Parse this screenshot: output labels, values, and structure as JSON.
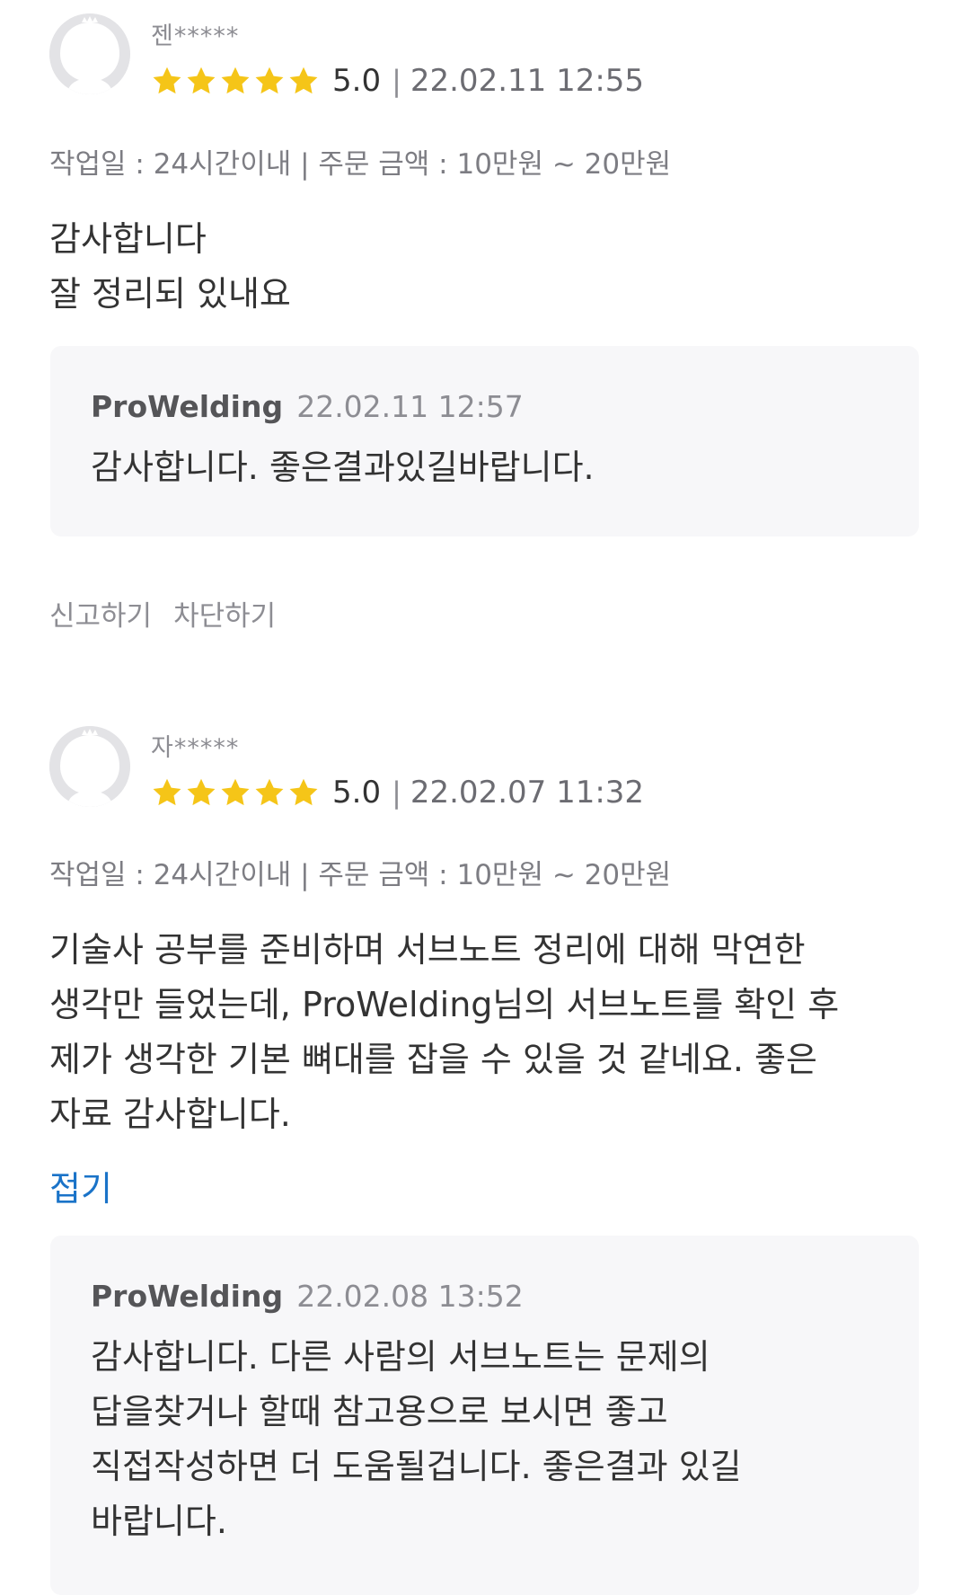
{
  "reviews": [
    {
      "author": "젠*****",
      "rating_value": 5,
      "score": "5.0",
      "separator": "|",
      "date": "22.02.11 12:55",
      "meta": "작업일 : 24시간이내 | 주문 금액 : 10만원 ~ 20만원",
      "body": "감사합니다\n잘 정리되 있내요",
      "reply": {
        "name": "ProWelding",
        "date": "22.02.11 12:57",
        "text": "감사합니다. 좋은결과있길바랍니다."
      },
      "actions": {
        "report": "신고하기",
        "block": "차단하기"
      }
    },
    {
      "author": "자*****",
      "rating_value": 5,
      "score": "5.0",
      "separator": "|",
      "date": "22.02.07 11:32",
      "meta": "작업일 : 24시간이내 | 주문 금액 : 10만원 ~ 20만원",
      "body": "기술사 공부를 준비하며 서브노트 정리에 대해 막연한\n생각만 들었는데, ProWelding님의 서브노트를 확인 후\n제가 생각한 기본 뼈대를 잡을 수 있을 것 같네요.  좋은\n자료 감사합니다.",
      "fold_label": "접기",
      "reply": {
        "name": "ProWelding",
        "date": "22.02.08 13:52",
        "text": "감사합니다. 다른 사람의 서브노트는 문제의\n답을찾거나 할때 참고용으로 보시면 좋고\n직접작성하면 더 도움될겁니다. 좋은결과 있길\n바랍니다."
      }
    }
  ],
  "colors": {
    "star": "#f5c518",
    "link": "#1a73c8",
    "reply_bg": "#f7f7f9",
    "avatar_bg": "#e3e3e6"
  },
  "icons": {
    "avatar": "default-user-avatar-icon",
    "star": "star-icon"
  }
}
